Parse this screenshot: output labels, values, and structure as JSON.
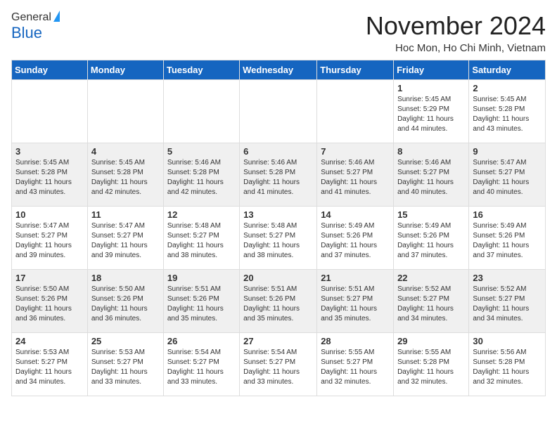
{
  "header": {
    "logo_general": "General",
    "logo_blue": "Blue",
    "month_title": "November 2024",
    "location": "Hoc Mon, Ho Chi Minh, Vietnam"
  },
  "weekdays": [
    "Sunday",
    "Monday",
    "Tuesday",
    "Wednesday",
    "Thursday",
    "Friday",
    "Saturday"
  ],
  "weeks": [
    [
      {
        "day": "",
        "info": ""
      },
      {
        "day": "",
        "info": ""
      },
      {
        "day": "",
        "info": ""
      },
      {
        "day": "",
        "info": ""
      },
      {
        "day": "",
        "info": ""
      },
      {
        "day": "1",
        "info": "Sunrise: 5:45 AM\nSunset: 5:29 PM\nDaylight: 11 hours and 44 minutes."
      },
      {
        "day": "2",
        "info": "Sunrise: 5:45 AM\nSunset: 5:28 PM\nDaylight: 11 hours and 43 minutes."
      }
    ],
    [
      {
        "day": "3",
        "info": "Sunrise: 5:45 AM\nSunset: 5:28 PM\nDaylight: 11 hours and 43 minutes."
      },
      {
        "day": "4",
        "info": "Sunrise: 5:45 AM\nSunset: 5:28 PM\nDaylight: 11 hours and 42 minutes."
      },
      {
        "day": "5",
        "info": "Sunrise: 5:46 AM\nSunset: 5:28 PM\nDaylight: 11 hours and 42 minutes."
      },
      {
        "day": "6",
        "info": "Sunrise: 5:46 AM\nSunset: 5:28 PM\nDaylight: 11 hours and 41 minutes."
      },
      {
        "day": "7",
        "info": "Sunrise: 5:46 AM\nSunset: 5:27 PM\nDaylight: 11 hours and 41 minutes."
      },
      {
        "day": "8",
        "info": "Sunrise: 5:46 AM\nSunset: 5:27 PM\nDaylight: 11 hours and 40 minutes."
      },
      {
        "day": "9",
        "info": "Sunrise: 5:47 AM\nSunset: 5:27 PM\nDaylight: 11 hours and 40 minutes."
      }
    ],
    [
      {
        "day": "10",
        "info": "Sunrise: 5:47 AM\nSunset: 5:27 PM\nDaylight: 11 hours and 39 minutes."
      },
      {
        "day": "11",
        "info": "Sunrise: 5:47 AM\nSunset: 5:27 PM\nDaylight: 11 hours and 39 minutes."
      },
      {
        "day": "12",
        "info": "Sunrise: 5:48 AM\nSunset: 5:27 PM\nDaylight: 11 hours and 38 minutes."
      },
      {
        "day": "13",
        "info": "Sunrise: 5:48 AM\nSunset: 5:27 PM\nDaylight: 11 hours and 38 minutes."
      },
      {
        "day": "14",
        "info": "Sunrise: 5:49 AM\nSunset: 5:26 PM\nDaylight: 11 hours and 37 minutes."
      },
      {
        "day": "15",
        "info": "Sunrise: 5:49 AM\nSunset: 5:26 PM\nDaylight: 11 hours and 37 minutes."
      },
      {
        "day": "16",
        "info": "Sunrise: 5:49 AM\nSunset: 5:26 PM\nDaylight: 11 hours and 37 minutes."
      }
    ],
    [
      {
        "day": "17",
        "info": "Sunrise: 5:50 AM\nSunset: 5:26 PM\nDaylight: 11 hours and 36 minutes."
      },
      {
        "day": "18",
        "info": "Sunrise: 5:50 AM\nSunset: 5:26 PM\nDaylight: 11 hours and 36 minutes."
      },
      {
        "day": "19",
        "info": "Sunrise: 5:51 AM\nSunset: 5:26 PM\nDaylight: 11 hours and 35 minutes."
      },
      {
        "day": "20",
        "info": "Sunrise: 5:51 AM\nSunset: 5:26 PM\nDaylight: 11 hours and 35 minutes."
      },
      {
        "day": "21",
        "info": "Sunrise: 5:51 AM\nSunset: 5:27 PM\nDaylight: 11 hours and 35 minutes."
      },
      {
        "day": "22",
        "info": "Sunrise: 5:52 AM\nSunset: 5:27 PM\nDaylight: 11 hours and 34 minutes."
      },
      {
        "day": "23",
        "info": "Sunrise: 5:52 AM\nSunset: 5:27 PM\nDaylight: 11 hours and 34 minutes."
      }
    ],
    [
      {
        "day": "24",
        "info": "Sunrise: 5:53 AM\nSunset: 5:27 PM\nDaylight: 11 hours and 34 minutes."
      },
      {
        "day": "25",
        "info": "Sunrise: 5:53 AM\nSunset: 5:27 PM\nDaylight: 11 hours and 33 minutes."
      },
      {
        "day": "26",
        "info": "Sunrise: 5:54 AM\nSunset: 5:27 PM\nDaylight: 11 hours and 33 minutes."
      },
      {
        "day": "27",
        "info": "Sunrise: 5:54 AM\nSunset: 5:27 PM\nDaylight: 11 hours and 33 minutes."
      },
      {
        "day": "28",
        "info": "Sunrise: 5:55 AM\nSunset: 5:27 PM\nDaylight: 11 hours and 32 minutes."
      },
      {
        "day": "29",
        "info": "Sunrise: 5:55 AM\nSunset: 5:28 PM\nDaylight: 11 hours and 32 minutes."
      },
      {
        "day": "30",
        "info": "Sunrise: 5:56 AM\nSunset: 5:28 PM\nDaylight: 11 hours and 32 minutes."
      }
    ]
  ]
}
